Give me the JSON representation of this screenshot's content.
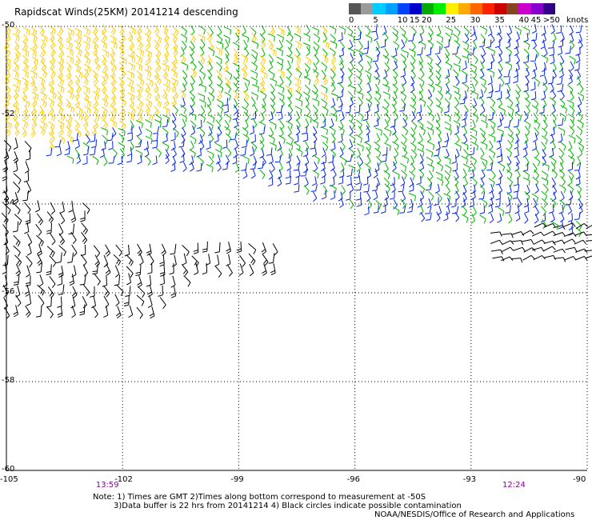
{
  "title": "Rapidscat Winds(25KM) 20141214 descending",
  "legend": {
    "unit_label": "knots",
    "bins": [
      {
        "label": "0",
        "color": "#555555"
      },
      {
        "label": "",
        "color": "#9a9a9a"
      },
      {
        "label": "5",
        "color": "#00ccff"
      },
      {
        "label": "",
        "color": "#00a0ff"
      },
      {
        "label": "10",
        "color": "#0044ff"
      },
      {
        "label": "15",
        "color": "#0000cc"
      },
      {
        "label": "20",
        "color": "#00aa00"
      },
      {
        "label": "",
        "color": "#00ee00"
      },
      {
        "label": "25",
        "color": "#ffee00"
      },
      {
        "label": "",
        "color": "#ffaa00"
      },
      {
        "label": "30",
        "color": "#ff6600"
      },
      {
        "label": "",
        "color": "#ff2200"
      },
      {
        "label": "35",
        "color": "#cc0000"
      },
      {
        "label": "",
        "color": "#884422"
      },
      {
        "label": "40",
        "color": "#cc00cc"
      },
      {
        "label": "45",
        "color": "#8800cc"
      },
      {
        "label": ">50",
        "color": "#330088"
      }
    ]
  },
  "axes": {
    "lon_ticks": [
      "-105",
      "-102",
      "-99",
      "-96",
      "-93",
      "-90"
    ],
    "lat_ticks": [
      "-50",
      "-52",
      "-54",
      "-56",
      "-58",
      "-60"
    ],
    "lon_range": [
      -105,
      -90
    ],
    "lat_range": [
      -60,
      -50
    ]
  },
  "pass_times": [
    {
      "label": "13:59",
      "lon": -102.4
    },
    {
      "label": "12:24",
      "lon": -91.9
    }
  ],
  "notes": {
    "line1": "Note: 1) Times are GMT 2)Times along bottom correspond to measurement at -50S",
    "line2": "3)Data buffer is 22 hrs from 20141214 4) Black circles indicate possible contamination",
    "credit": "NOAA/NESDIS/Office of Research and Applications"
  },
  "wind_colors": {
    "yellow": "#ffcc00",
    "green": "#00b400",
    "blue": "#0022ee",
    "black": "#000000"
  }
}
